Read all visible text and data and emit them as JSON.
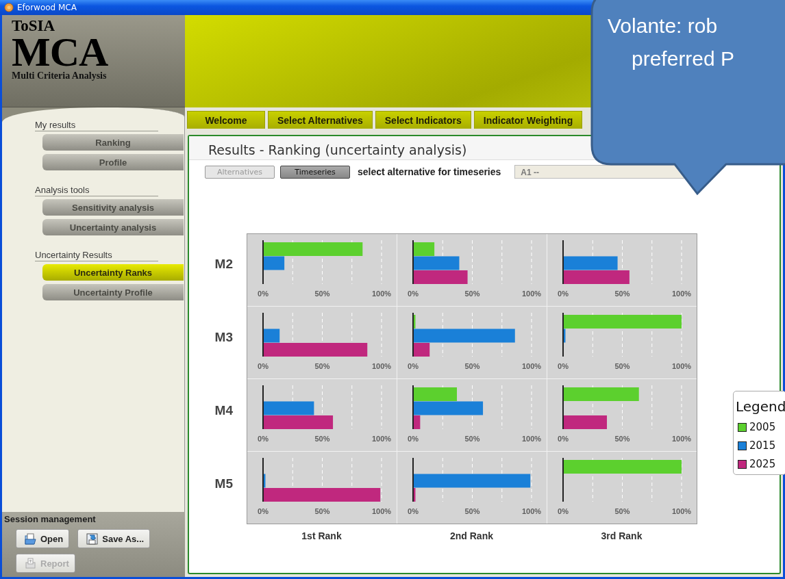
{
  "window": {
    "title": "Eforwood MCA"
  },
  "logo": {
    "line_1": "ToSIA",
    "line_2": "MCA",
    "line_3": "Multi Criteria Analysis"
  },
  "sidebar": {
    "sections": [
      {
        "heading": "My results",
        "items": [
          {
            "label": "Ranking",
            "selected": false
          },
          {
            "label": "Profile",
            "selected": false
          }
        ]
      },
      {
        "heading": "Analysis tools",
        "items": [
          {
            "label": "Sensitivity analysis",
            "selected": false
          },
          {
            "label": "Uncertainty analysis",
            "selected": false
          }
        ]
      },
      {
        "heading": "Uncertainty Results",
        "items": [
          {
            "label": "Uncertainty Ranks",
            "selected": true
          },
          {
            "label": "Uncertainty Profile",
            "selected": false
          }
        ]
      }
    ]
  },
  "session": {
    "heading": "Session management",
    "buttons": [
      {
        "kind": "open",
        "label": "Open",
        "disabled": false
      },
      {
        "kind": "save",
        "label": "Save As...",
        "disabled": false
      },
      {
        "kind": "report",
        "label": "Report",
        "disabled": true
      }
    ]
  },
  "tabs": [
    {
      "label": "Welcome",
      "selected": false
    },
    {
      "label": "Select Alternatives",
      "selected": false
    },
    {
      "label": "Select Indicators",
      "selected": false
    },
    {
      "label": "Indicator Weighting",
      "selected": false
    }
  ],
  "panel": {
    "title": "Results - Ranking (uncertainty analysis)",
    "toggles": [
      {
        "label": "Alternatives",
        "selected": false
      },
      {
        "label": "Timeseries",
        "selected": true
      }
    ],
    "select_label": "select alternative for timeseries",
    "select_value": "A1 --",
    "grid": {
      "rows": [
        "M2",
        "M3",
        "M4",
        "M5"
      ],
      "columns": [
        "1st Rank",
        "2nd Rank",
        "3rd Rank"
      ],
      "charts": [
        {
          "chart_data": {
            "type": "bar",
            "orientation": "horizontal",
            "xlim": [
              0,
              1
            ],
            "xticks": [
              {
                "value": 0,
                "label": "0%"
              },
              {
                "value": 0.5,
                "label": "50%"
              },
              {
                "value": 1,
                "label": "100%"
              }
            ],
            "series": [
              {
                "color": "#5cd02e",
                "values": [
                  0.84
                ]
              },
              {
                "color": "#1a80d8",
                "values": [
                  0.18
                ]
              },
              {
                "color": "#c0287e",
                "values": [
                  0
                ]
              }
            ]
          }
        },
        {
          "chart_data": {
            "type": "bar",
            "orientation": "horizontal",
            "xlim": [
              0,
              1
            ],
            "xticks": [
              {
                "value": 0,
                "label": "0%"
              },
              {
                "value": 0.5,
                "label": "50%"
              },
              {
                "value": 1,
                "label": "100%"
              }
            ],
            "series": [
              {
                "color": "#5cd02e",
                "values": [
                  0.18
                ]
              },
              {
                "color": "#1a80d8",
                "values": [
                  0.39
                ]
              },
              {
                "color": "#c0287e",
                "values": [
                  0.46
                ]
              }
            ]
          }
        },
        {
          "chart_data": {
            "type": "bar",
            "orientation": "horizontal",
            "xlim": [
              0,
              1
            ],
            "xticks": [
              {
                "value": 0,
                "label": "0%"
              },
              {
                "value": 0.5,
                "label": "50%"
              },
              {
                "value": 1,
                "label": "100%"
              }
            ],
            "series": [
              {
                "color": "#5cd02e",
                "values": [
                  0
                ]
              },
              {
                "color": "#1a80d8",
                "values": [
                  0.46
                ]
              },
              {
                "color": "#c0287e",
                "values": [
                  0.56
                ]
              }
            ]
          }
        },
        {
          "chart_data": {
            "type": "bar",
            "orientation": "horizontal",
            "xlim": [
              0,
              1
            ],
            "xticks": [
              {
                "value": 0,
                "label": "0%"
              },
              {
                "value": 0.5,
                "label": "50%"
              },
              {
                "value": 1,
                "label": "100%"
              }
            ],
            "series": [
              {
                "color": "#5cd02e",
                "values": [
                  0
                ]
              },
              {
                "color": "#1a80d8",
                "values": [
                  0.14
                ]
              },
              {
                "color": "#c0287e",
                "values": [
                  0.88
                ]
              }
            ]
          }
        },
        {
          "chart_data": {
            "type": "bar",
            "orientation": "horizontal",
            "xlim": [
              0,
              1
            ],
            "xticks": [
              {
                "value": 0,
                "label": "0%"
              },
              {
                "value": 0.5,
                "label": "50%"
              },
              {
                "value": 1,
                "label": "100%"
              }
            ],
            "series": [
              {
                "color": "#5cd02e",
                "values": [
                  0.02
                ]
              },
              {
                "color": "#1a80d8",
                "values": [
                  0.86
                ]
              },
              {
                "color": "#c0287e",
                "values": [
                  0.14
                ]
              }
            ]
          }
        },
        {
          "chart_data": {
            "type": "bar",
            "orientation": "horizontal",
            "xlim": [
              0,
              1
            ],
            "xticks": [
              {
                "value": 0,
                "label": "0%"
              },
              {
                "value": 0.5,
                "label": "50%"
              },
              {
                "value": 1,
                "label": "100%"
              }
            ],
            "series": [
              {
                "color": "#5cd02e",
                "values": [
                  1.0
                ]
              },
              {
                "color": "#1a80d8",
                "values": [
                  0.02
                ]
              },
              {
                "color": "#c0287e",
                "values": [
                  0
                ]
              }
            ]
          }
        },
        {
          "chart_data": {
            "type": "bar",
            "orientation": "horizontal",
            "xlim": [
              0,
              1
            ],
            "xticks": [
              {
                "value": 0,
                "label": "0%"
              },
              {
                "value": 0.5,
                "label": "50%"
              },
              {
                "value": 1,
                "label": "100%"
              }
            ],
            "series": [
              {
                "color": "#5cd02e",
                "values": [
                  0
                ]
              },
              {
                "color": "#1a80d8",
                "values": [
                  0.43
                ]
              },
              {
                "color": "#c0287e",
                "values": [
                  0.59
                ]
              }
            ]
          }
        },
        {
          "chart_data": {
            "type": "bar",
            "orientation": "horizontal",
            "xlim": [
              0,
              1
            ],
            "xticks": [
              {
                "value": 0,
                "label": "0%"
              },
              {
                "value": 0.5,
                "label": "50%"
              },
              {
                "value": 1,
                "label": "100%"
              }
            ],
            "series": [
              {
                "color": "#5cd02e",
                "values": [
                  0.37
                ]
              },
              {
                "color": "#1a80d8",
                "values": [
                  0.59
                ]
              },
              {
                "color": "#c0287e",
                "values": [
                  0.06
                ]
              }
            ]
          }
        },
        {
          "chart_data": {
            "type": "bar",
            "orientation": "horizontal",
            "xlim": [
              0,
              1
            ],
            "xticks": [
              {
                "value": 0,
                "label": "0%"
              },
              {
                "value": 0.5,
                "label": "50%"
              },
              {
                "value": 1,
                "label": "100%"
              }
            ],
            "series": [
              {
                "color": "#5cd02e",
                "values": [
                  0.64
                ]
              },
              {
                "color": "#1a80d8",
                "values": [
                  0
                ]
              },
              {
                "color": "#c0287e",
                "values": [
                  0.37
                ]
              }
            ]
          }
        },
        {
          "chart_data": {
            "type": "bar",
            "orientation": "horizontal",
            "xlim": [
              0,
              1
            ],
            "xticks": [
              {
                "value": 0,
                "label": "0%"
              },
              {
                "value": 0.5,
                "label": "50%"
              },
              {
                "value": 1,
                "label": "100%"
              }
            ],
            "series": [
              {
                "color": "#5cd02e",
                "values": [
                  0
                ]
              },
              {
                "color": "#1a80d8",
                "values": [
                  0.02
                ]
              },
              {
                "color": "#c0287e",
                "values": [
                  0.99
                ]
              }
            ]
          }
        },
        {
          "chart_data": {
            "type": "bar",
            "orientation": "horizontal",
            "xlim": [
              0,
              1
            ],
            "xticks": [
              {
                "value": 0,
                "label": "0%"
              },
              {
                "value": 0.5,
                "label": "50%"
              },
              {
                "value": 1,
                "label": "100%"
              }
            ],
            "series": [
              {
                "color": "#5cd02e",
                "values": [
                  0
                ]
              },
              {
                "color": "#1a80d8",
                "values": [
                  0.99
                ]
              },
              {
                "color": "#c0287e",
                "values": [
                  0.02
                ]
              }
            ]
          }
        },
        {
          "chart_data": {
            "type": "bar",
            "orientation": "horizontal",
            "xlim": [
              0,
              1
            ],
            "xticks": [
              {
                "value": 0,
                "label": "0%"
              },
              {
                "value": 0.5,
                "label": "50%"
              },
              {
                "value": 1,
                "label": "100%"
              }
            ],
            "series": [
              {
                "color": "#5cd02e",
                "values": [
                  1.0
                ]
              },
              {
                "color": "#1a80d8",
                "values": [
                  0
                ]
              },
              {
                "color": "#c0287e",
                "values": [
                  0
                ]
              }
            ]
          }
        }
      ]
    },
    "legend": {
      "title": "Legend",
      "items": [
        {
          "label": "2005",
          "color": "#5cd02e"
        },
        {
          "label": "2015",
          "color": "#1a80d8"
        },
        {
          "label": "2025",
          "color": "#c0287e"
        }
      ]
    }
  },
  "callout": {
    "lines": [
      "Volante: rob",
      "preferred P"
    ]
  }
}
